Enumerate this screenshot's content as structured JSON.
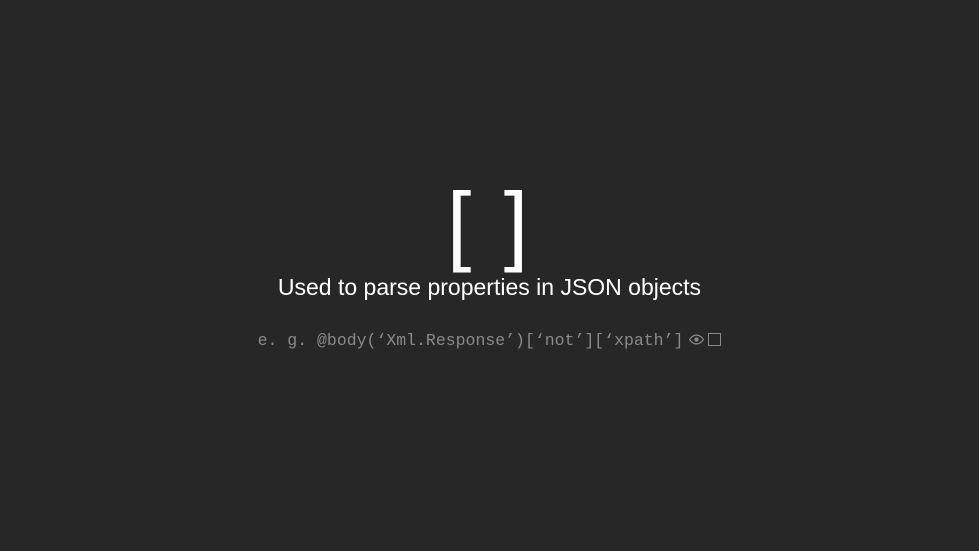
{
  "slide": {
    "symbol": "[ ]",
    "subtitle": "Used to parse properties in JSON objects",
    "example_prefix": "e. g. ",
    "example_code": "@body(‘Xml.Response’)[‘not’][‘xpath’]"
  },
  "icons": {
    "eye": "eye-icon",
    "box": "box-icon"
  },
  "colors": {
    "background": "#272727",
    "heading": "#ffffff",
    "muted": "#8a8a8a"
  }
}
